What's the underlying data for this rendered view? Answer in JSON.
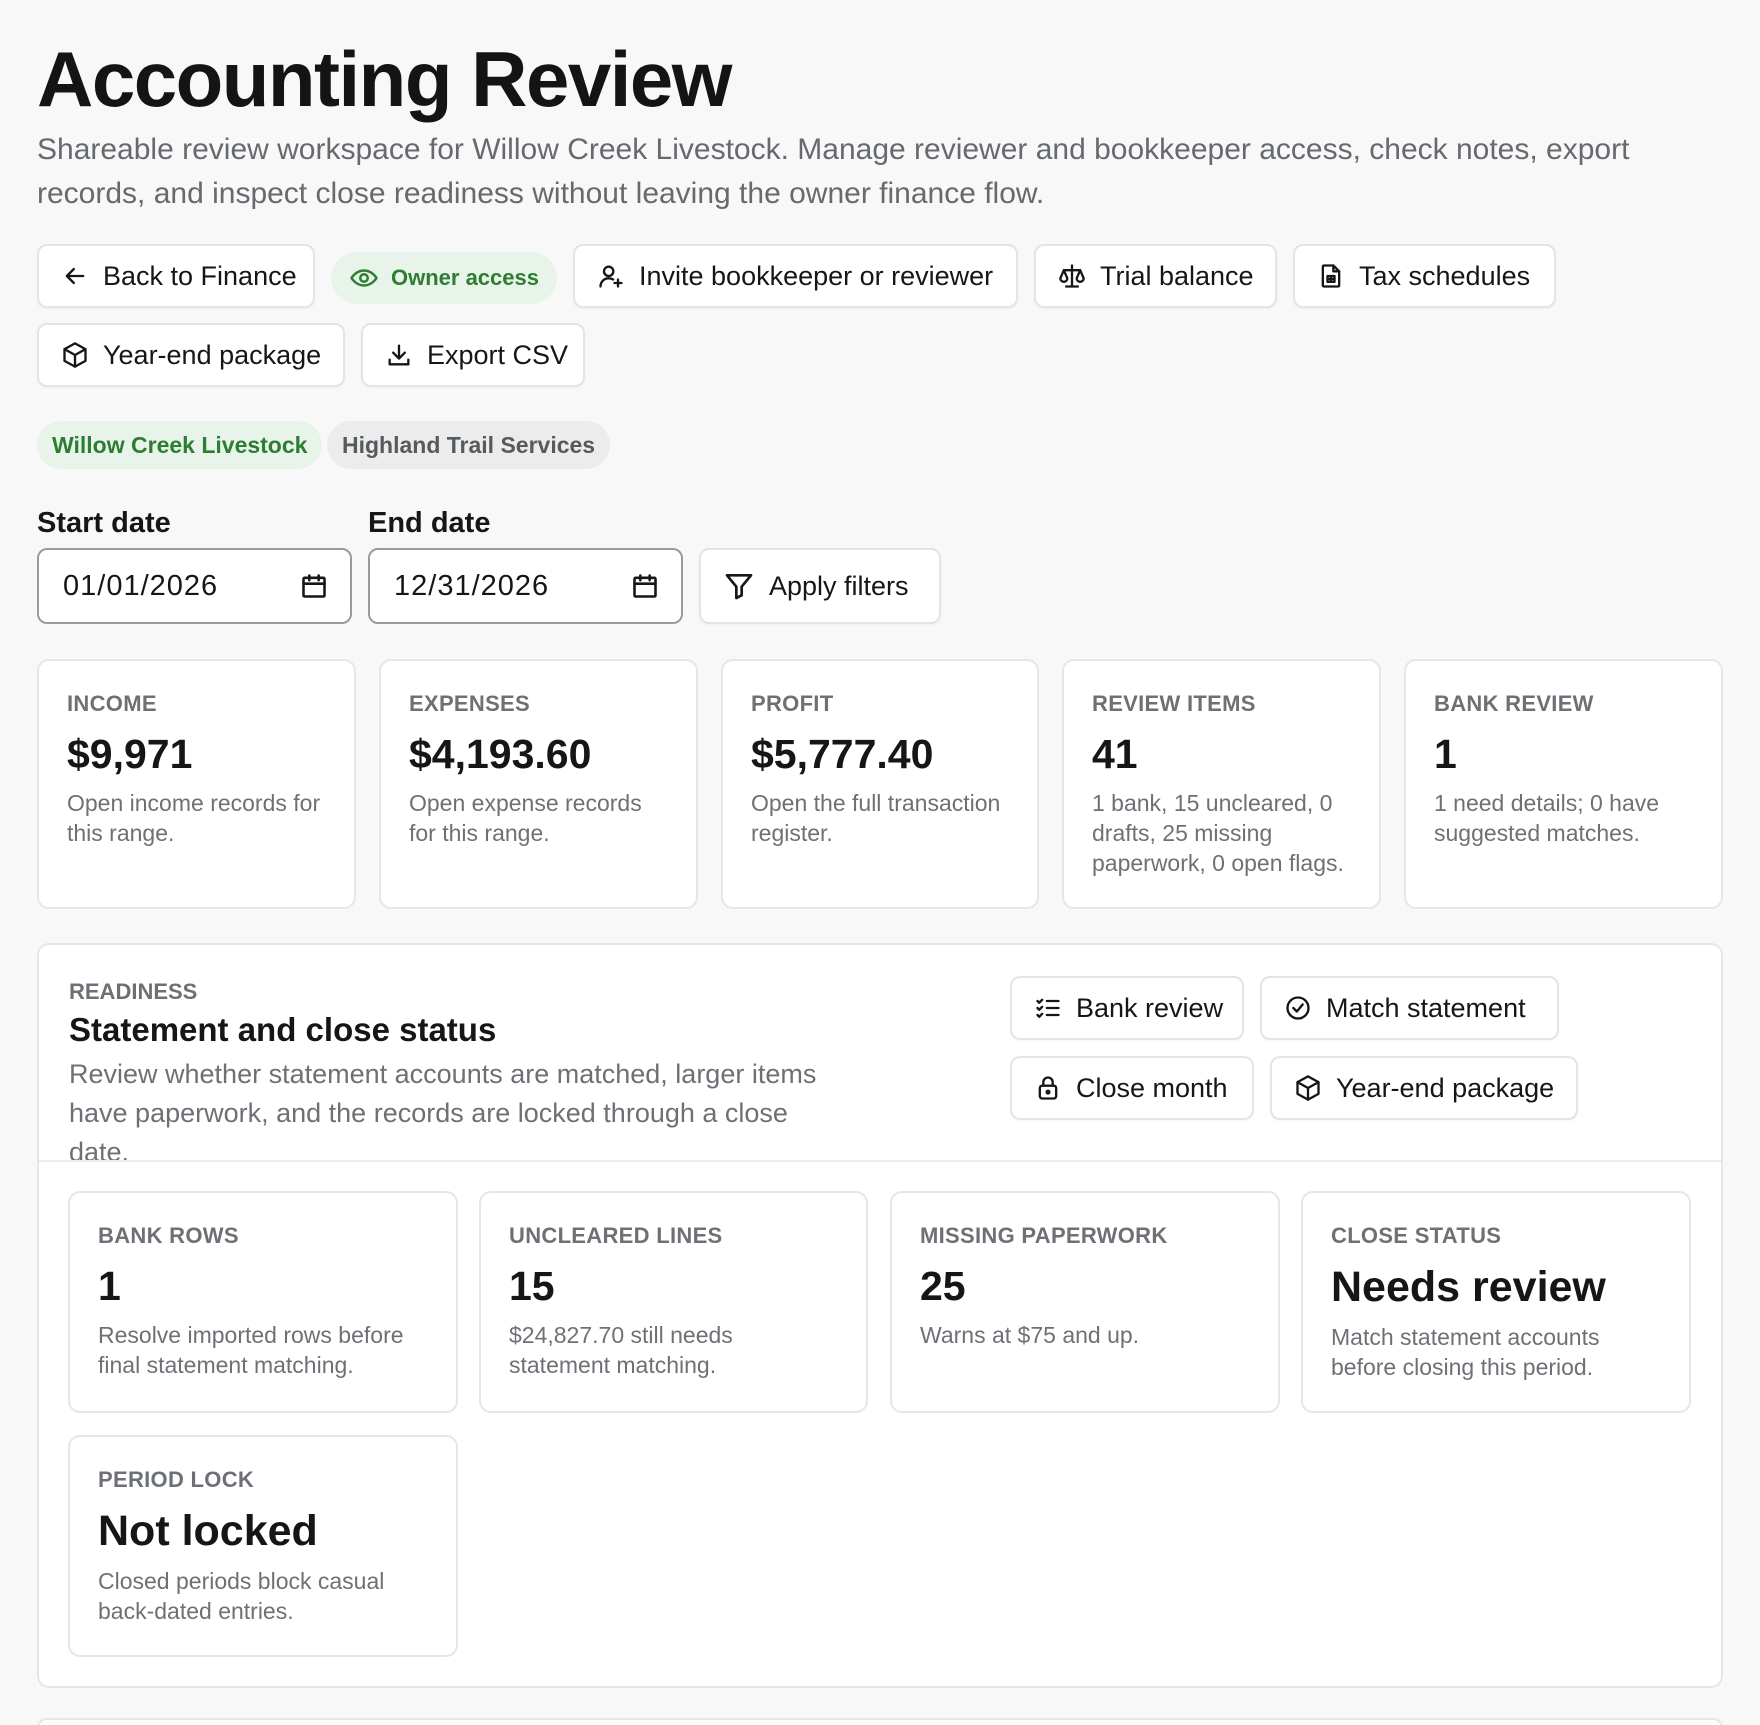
{
  "header": {
    "title": "Accounting Review",
    "subtitle": "Shareable review workspace for Willow Creek Livestock. Manage reviewer and bookkeeper access, check notes, export records, and inspect close readiness without leaving the owner finance flow."
  },
  "toolbar": {
    "back_label": "Back to Finance",
    "access_badge": "Owner access",
    "invite_label": "Invite bookkeeper or reviewer",
    "trial_balance_label": "Trial balance",
    "tax_schedules_label": "Tax schedules",
    "year_end_label": "Year-end package",
    "export_label": "Export CSV"
  },
  "businesses": {
    "items": [
      {
        "label": "Willow Creek Livestock",
        "active": true
      },
      {
        "label": "Highland Trail Services",
        "active": false
      }
    ]
  },
  "filters": {
    "start_label": "Start date",
    "start_value": "01/01/2026",
    "end_label": "End date",
    "end_value": "12/31/2026",
    "apply_label": "Apply filters"
  },
  "metrics": [
    {
      "label": "INCOME",
      "value": "$9,971",
      "desc": "Open income records for this range."
    },
    {
      "label": "EXPENSES",
      "value": "$4,193.60",
      "desc": "Open expense records for this range."
    },
    {
      "label": "PROFIT",
      "value": "$5,777.40",
      "desc": "Open the full transaction register."
    },
    {
      "label": "REVIEW ITEMS",
      "value": "41",
      "desc": "1 bank, 15 uncleared, 0 drafts, 25 missing paperwork, 0 open flags."
    },
    {
      "label": "BANK REVIEW",
      "value": "1",
      "desc": "1 need details; 0 have suggested matches."
    }
  ],
  "readiness": {
    "section_label": "READINESS",
    "title": "Statement and close status",
    "description": "Review whether statement accounts are matched, larger items have paperwork, and the records are locked through a close date.",
    "actions": {
      "bank_review": "Bank review",
      "match_statement": "Match statement",
      "close_month": "Close month",
      "year_end": "Year-end package"
    },
    "cards": [
      {
        "label": "BANK ROWS",
        "value": "1",
        "desc": "Resolve imported rows before final statement matching."
      },
      {
        "label": "UNCLEARED LINES",
        "value": "15",
        "desc": "$24,827.70 still needs statement matching."
      },
      {
        "label": "MISSING PAPERWORK",
        "value": "25",
        "desc": "Warns at $75 and up."
      },
      {
        "label": "CLOSE STATUS",
        "value": "Needs review",
        "desc": "Match statement accounts before closing this period."
      },
      {
        "label": "PERIOD LOCK",
        "value": "Not locked",
        "desc": "Closed periods block casual back-dated entries."
      }
    ]
  },
  "icons": {
    "back": "arrow-left-icon",
    "access": "eye-icon",
    "invite": "user-plus-icon",
    "trial_balance": "scale-icon",
    "tax": "document-icon",
    "package": "box-icon",
    "export": "download-icon",
    "calendar": "calendar-icon",
    "filter": "filter-icon",
    "list": "list-check-icon",
    "check": "check-circle-icon",
    "lock": "lock-icon"
  },
  "colors": {
    "accent_green": "#2e7d32",
    "accent_green_bg": "#e8f4e9",
    "muted_text": "#6d7175",
    "border": "#e4e4e4"
  }
}
